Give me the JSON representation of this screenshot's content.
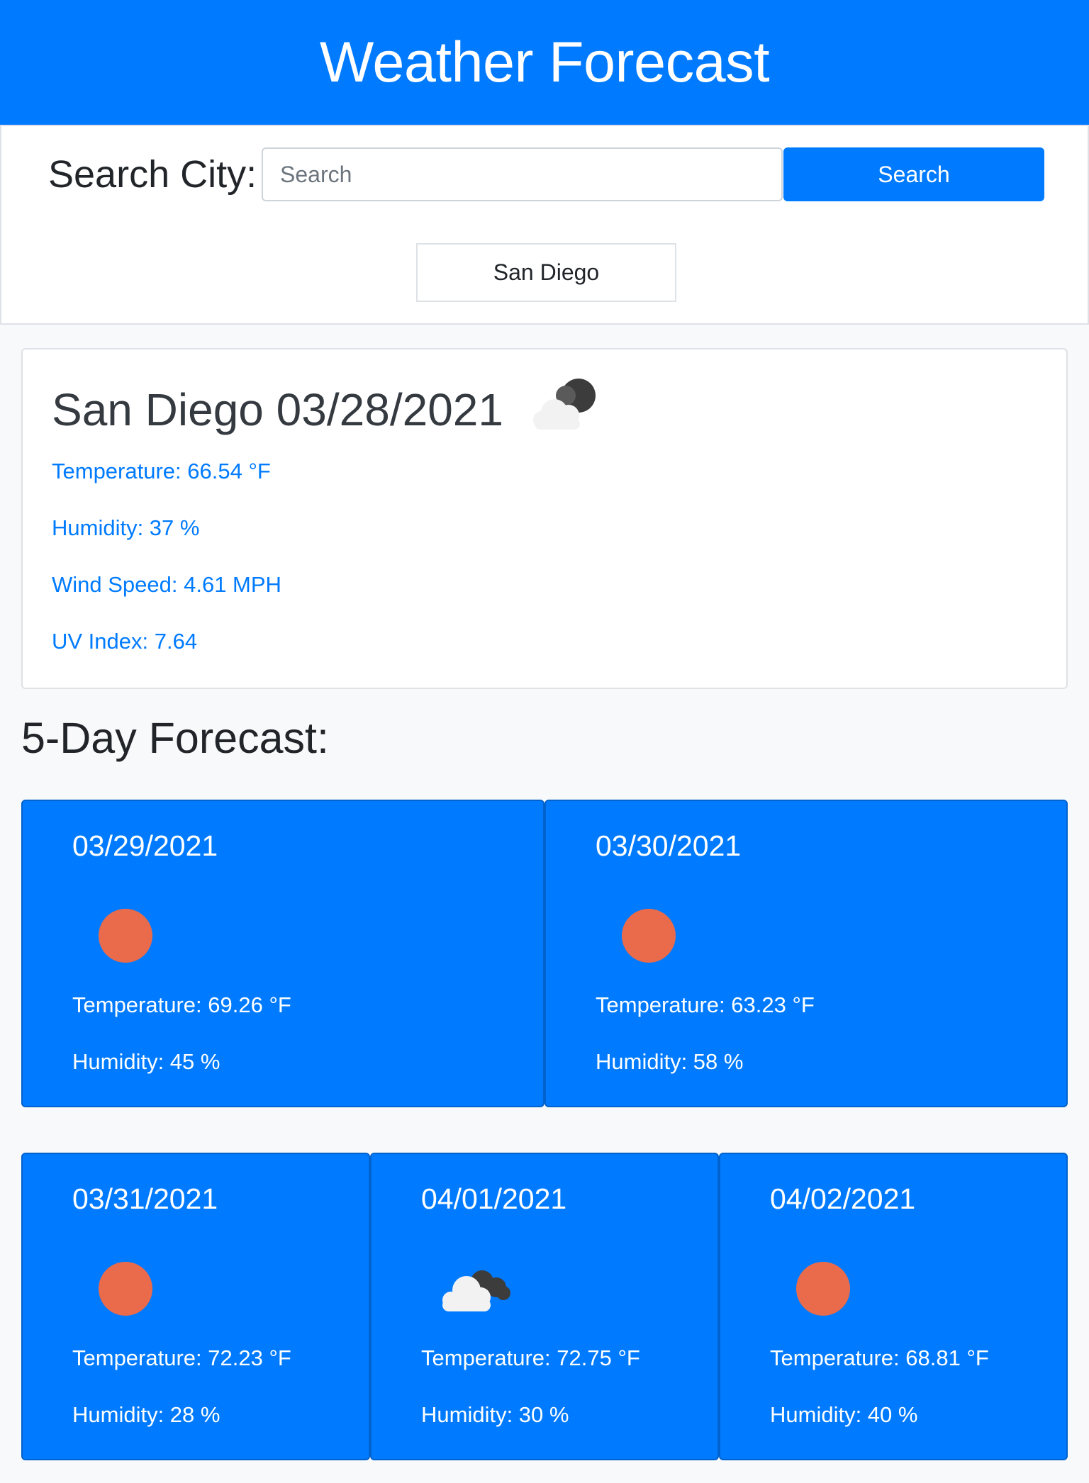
{
  "header": {
    "title": "Weather Forecast"
  },
  "search": {
    "label": "Search City:",
    "placeholder": "Search",
    "value": "",
    "button_label": "Search"
  },
  "history": [
    {
      "label": "San Diego"
    }
  ],
  "current": {
    "title": "San Diego 03/28/2021",
    "icon": "cloud-moon-icon",
    "temperature": "Temperature: 66.54 °F",
    "humidity": "Humidity: 37 %",
    "wind": "Wind Speed: 4.61 MPH",
    "uv": "UV Index: 7.64"
  },
  "forecast": {
    "heading": "5-Day Forecast:",
    "days": [
      {
        "date": "03/29/2021",
        "icon": "sun-icon",
        "temperature": "Temperature: 69.26 °F",
        "humidity": "Humidity: 45 %"
      },
      {
        "date": "03/30/2021",
        "icon": "sun-icon",
        "temperature": "Temperature: 63.23 °F",
        "humidity": "Humidity: 58 %"
      },
      {
        "date": "03/31/2021",
        "icon": "sun-icon",
        "temperature": "Temperature: 72.23 °F",
        "humidity": "Humidity: 28 %"
      },
      {
        "date": "04/01/2021",
        "icon": "cloud-icon",
        "temperature": "Temperature: 72.75 °F",
        "humidity": "Humidity: 30 %"
      },
      {
        "date": "04/02/2021",
        "icon": "sun-icon",
        "temperature": "Temperature: 68.81 °F",
        "humidity": "Humidity: 40 %"
      }
    ]
  },
  "colors": {
    "primary": "#007bff",
    "sun": "#e96b4b",
    "cloud": "#f2f2f2",
    "cloud_dark": "#3c3c3c"
  }
}
